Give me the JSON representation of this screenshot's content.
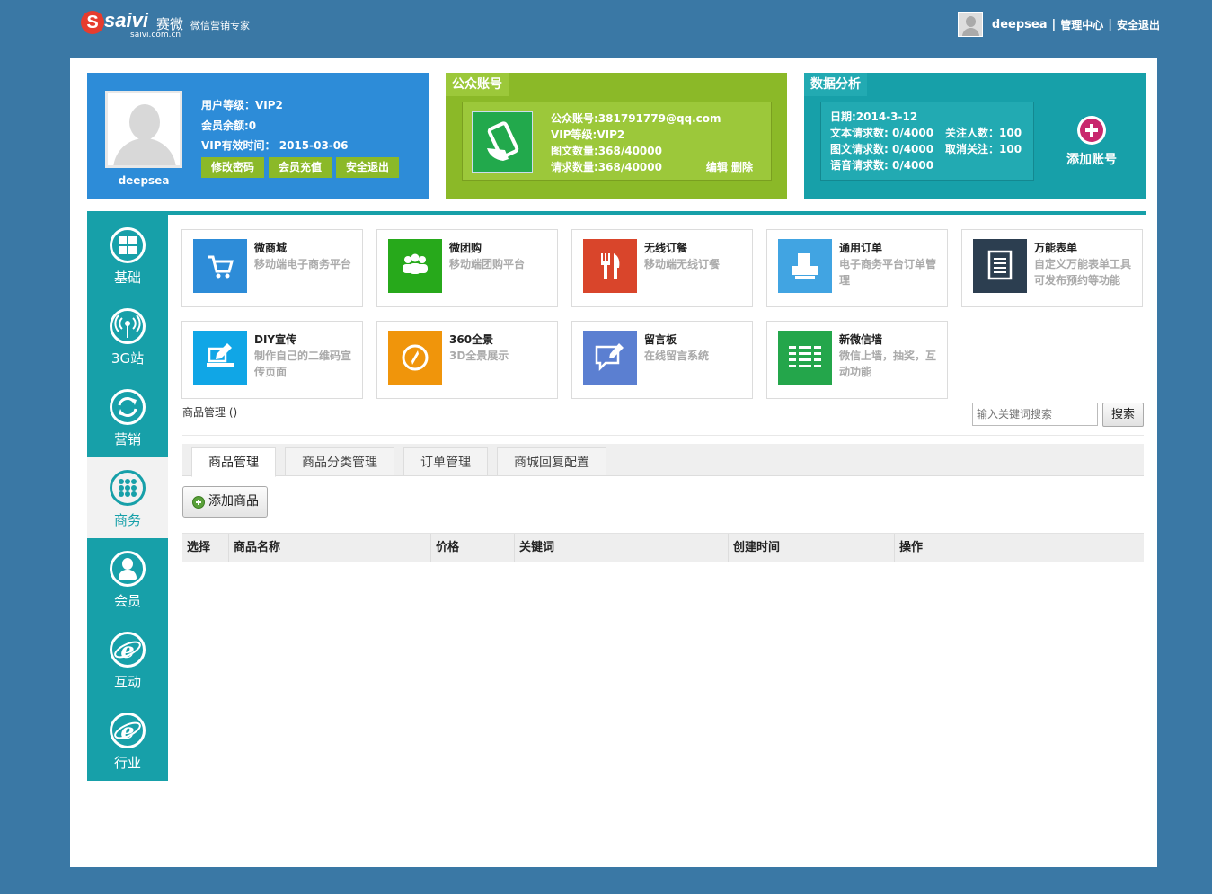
{
  "logo": {
    "letter": "S",
    "brand": "saivi",
    "cn": "赛微",
    "domain": "saivi.com.cn",
    "slogan": "微信营销专家"
  },
  "topbar": {
    "username": "deepsea",
    "sep1": "|",
    "manage": "管理中心",
    "sep2": "|",
    "logout": "安全退出"
  },
  "profile": {
    "username": "deepsea",
    "level": "用户等级：VIP2",
    "balance": "会员余额:0",
    "expiry": "VIP有效时间： 2015-03-06",
    "buttons": [
      "修改密码",
      "会员充值",
      "安全退出"
    ]
  },
  "account": {
    "title": "公众账号",
    "email": "公众账号:381791779@qq.com",
    "vip": "VIP等级:VIP2",
    "images": "图文数量:368/40000",
    "requests": "请求数量:368/40000",
    "actions": "编辑 删除"
  },
  "analytics": {
    "title": "数据分析",
    "date": "日期:2014-3-12",
    "text_req": "文本请求数: 0/4000",
    "image_req": "图文请求数: 0/4000",
    "voice_req": "语音请求数: 0/4000",
    "followers": "关注人数：100",
    "unfollow": "取消关注：100",
    "add_account": "添加账号"
  },
  "nav": [
    {
      "label": "基础",
      "icon": "grid-icon"
    },
    {
      "label": "3G站",
      "icon": "broadcast-icon"
    },
    {
      "label": "营销",
      "icon": "refresh-icon"
    },
    {
      "label": "商务",
      "icon": "dots-icon",
      "active": true
    },
    {
      "label": "会员",
      "icon": "user-icon"
    },
    {
      "label": "互动",
      "icon": "ie-icon"
    },
    {
      "label": "行业",
      "icon": "ie-icon"
    }
  ],
  "tiles": [
    {
      "name": "微商城",
      "desc": "移动端电子商务平台",
      "color": "#2d8cd8",
      "icon": "cart-icon"
    },
    {
      "name": "微团购",
      "desc": "移动端团购平台",
      "color": "#27a91b",
      "icon": "group-icon"
    },
    {
      "name": "无线订餐",
      "desc": "移动端无线订餐",
      "color": "#d9452b",
      "icon": "cutlery-icon"
    },
    {
      "name": "通用订单",
      "desc": "电子商务平台订单管理",
      "color": "#41a4e2",
      "icon": "printer-icon"
    },
    {
      "name": "万能表单",
      "desc": "自定义万能表单工具可发布预约等功能",
      "color": "#2c3e50",
      "icon": "form-icon"
    },
    {
      "name": "DIY宣传",
      "desc": "制作自己的二维码宣传页面",
      "color": "#10a6e6",
      "icon": "diy-icon"
    },
    {
      "name": "360全景",
      "desc": "3D全景展示",
      "color": "#f0950b",
      "icon": "compass-icon"
    },
    {
      "name": "留言板",
      "desc": "在线留言系统",
      "color": "#5b7fd1",
      "icon": "message-icon"
    },
    {
      "name": "新微信墙",
      "desc": "微信上墙，抽奖，互动功能",
      "color": "#24a64b",
      "icon": "wall-icon"
    }
  ],
  "breadcrumb": "商品管理 ()",
  "search": {
    "placeholder": "输入关键词搜索",
    "button": "搜索"
  },
  "tabs": [
    "商品管理",
    "商品分类管理",
    "订单管理",
    "商城回复配置"
  ],
  "add_button": "添加商品",
  "table": {
    "columns": [
      "选择",
      "商品名称",
      "价格",
      "关键词",
      "创建时间",
      "操作"
    ]
  }
}
